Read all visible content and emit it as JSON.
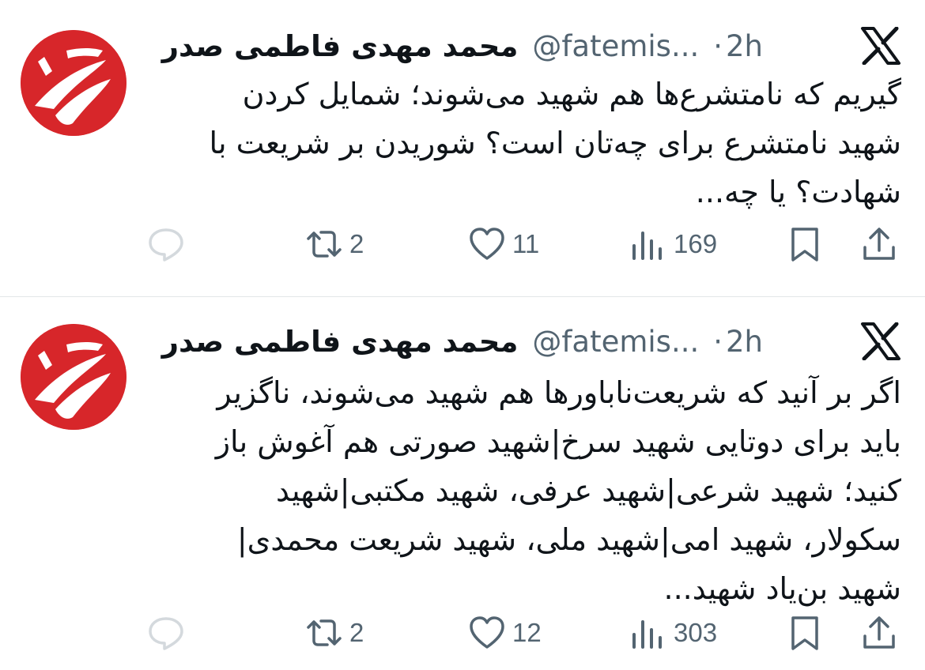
{
  "colors": {
    "text": "#0f1419",
    "secondary": "#536471",
    "avatar_red": "#d7262a",
    "divider": "#e3e6e8"
  },
  "tweets": [
    {
      "author_name": "محمد مهدی فاطمی صدر",
      "handle": "@fatemis...",
      "separator": "·",
      "time": "2h",
      "text": "گیریم که نامتشرع‌ها هم شهید می‌شوند؛ شمایل کردن\nشهید نامتشرع برای چه‌تان است؟ شوریدن بر شریعت با\nشهادت؟ یا چه...",
      "replies": "",
      "retweets": "2",
      "likes": "11",
      "views": "169",
      "icons": [
        "avatar-logo",
        "x-logo-icon",
        "reply-icon",
        "retweet-icon",
        "heart-icon",
        "views-icon",
        "bookmark-icon",
        "share-icon"
      ]
    },
    {
      "author_name": "محمد مهدی فاطمی صدر",
      "handle": "@fatemis...",
      "separator": "·",
      "time": "2h",
      "text": "اگر بر آنید که شریعت‌ناباورها هم شهید می‌شوند، ناگزیر\nباید برای دوتایی شهید سرخ|شهید صورتی هم آغوش باز\nکنید؛ شهید شرعی|شهید عرفی، شهید مکتبی|شهید\nسکولار، شهید امی|شهید ملی، شهید شریعت محمدی|\nشهید بن‌یاد شهید...",
      "replies": "",
      "retweets": "2",
      "likes": "12",
      "views": "303",
      "icons": [
        "avatar-logo",
        "x-logo-icon",
        "reply-icon",
        "retweet-icon",
        "heart-icon",
        "views-icon",
        "bookmark-icon",
        "share-icon"
      ]
    }
  ]
}
